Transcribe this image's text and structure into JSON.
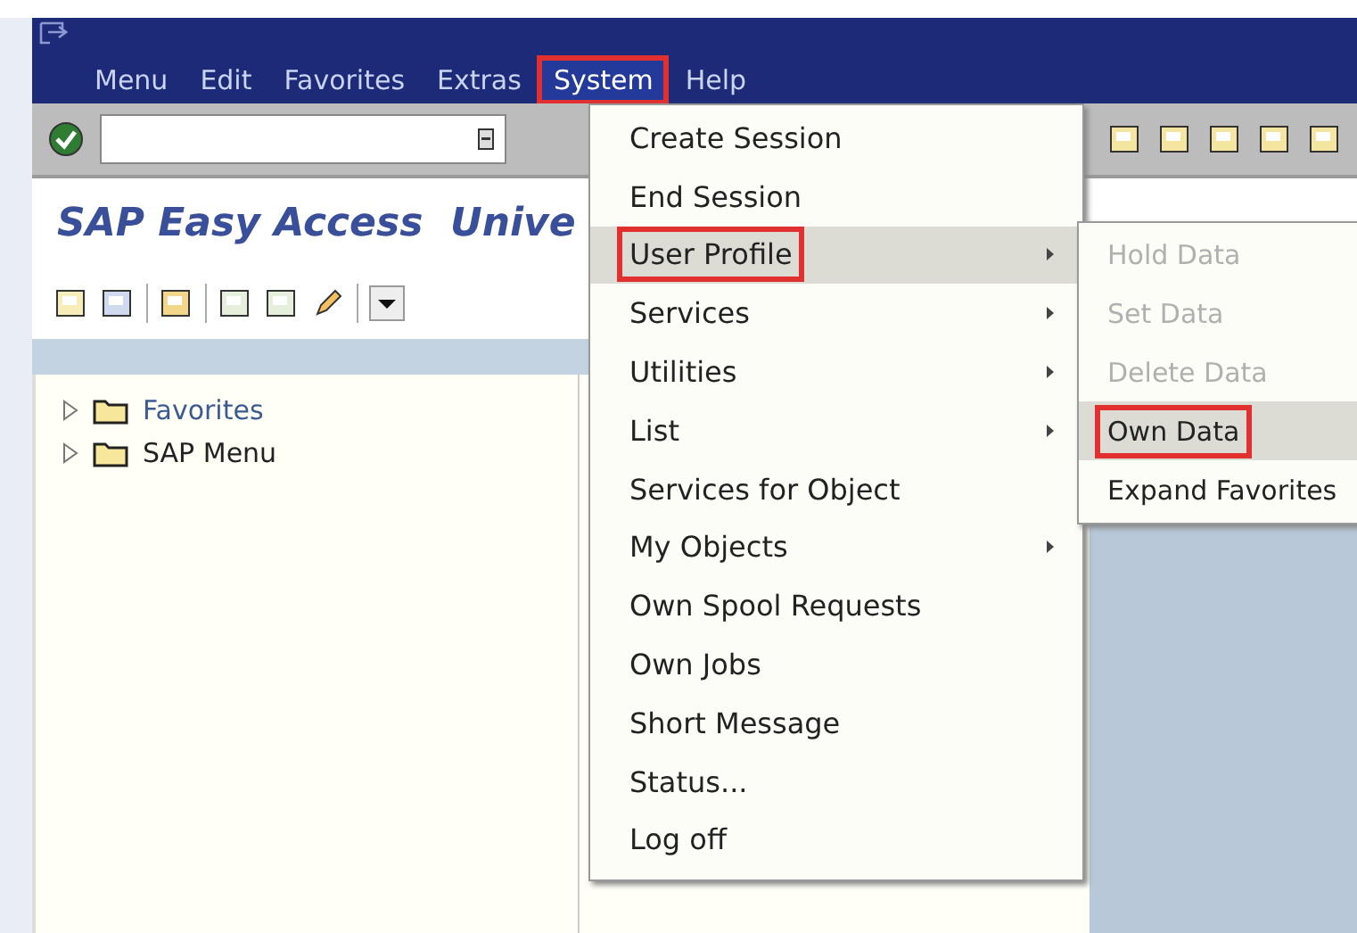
{
  "menubar": {
    "items": [
      {
        "label": "Menu",
        "selected": false,
        "highlighted": false
      },
      {
        "label": "Edit",
        "selected": false,
        "highlighted": false
      },
      {
        "label": "Favorites",
        "selected": false,
        "highlighted": false
      },
      {
        "label": "Extras",
        "selected": false,
        "highlighted": false
      },
      {
        "label": "System",
        "selected": true,
        "highlighted": true
      },
      {
        "label": "Help",
        "selected": false,
        "highlighted": false
      }
    ]
  },
  "title": "SAP Easy Access  Unive",
  "tree": [
    {
      "label": "Favorites",
      "expanded": false,
      "selected": true
    },
    {
      "label": "SAP Menu",
      "expanded": false,
      "selected": false
    }
  ],
  "system_menu": {
    "items": [
      {
        "label": "Create Session",
        "has_submenu": false,
        "selected": false,
        "highlighted": false
      },
      {
        "label": "End Session",
        "has_submenu": false,
        "selected": false,
        "highlighted": false
      },
      {
        "label": "User Profile",
        "has_submenu": true,
        "selected": true,
        "highlighted": true
      },
      {
        "label": "Services",
        "has_submenu": true,
        "selected": false,
        "highlighted": false
      },
      {
        "label": "Utilities",
        "has_submenu": true,
        "selected": false,
        "highlighted": false
      },
      {
        "label": "List",
        "has_submenu": true,
        "selected": false,
        "highlighted": false
      },
      {
        "label": "Services for Object",
        "has_submenu": false,
        "selected": false,
        "highlighted": false
      },
      {
        "label": "My Objects",
        "has_submenu": true,
        "selected": false,
        "highlighted": false
      },
      {
        "label": "Own Spool Requests",
        "has_submenu": false,
        "selected": false,
        "highlighted": false
      },
      {
        "label": "Own Jobs",
        "has_submenu": false,
        "selected": false,
        "highlighted": false
      },
      {
        "label": "Short Message",
        "has_submenu": false,
        "selected": false,
        "highlighted": false
      },
      {
        "label": "Status...",
        "has_submenu": false,
        "selected": false,
        "highlighted": false
      },
      {
        "label": "Log off",
        "has_submenu": false,
        "selected": false,
        "highlighted": false
      }
    ]
  },
  "user_profile_submenu": {
    "items": [
      {
        "label": "Hold Data",
        "disabled": true,
        "selected": false,
        "highlighted": false
      },
      {
        "label": "Set Data",
        "disabled": true,
        "selected": false,
        "highlighted": false
      },
      {
        "label": "Delete Data",
        "disabled": true,
        "selected": false,
        "highlighted": false
      },
      {
        "label": "Own Data",
        "disabled": false,
        "selected": true,
        "highlighted": true
      },
      {
        "label": "Expand Favorites",
        "disabled": false,
        "selected": false,
        "highlighted": false
      }
    ]
  }
}
